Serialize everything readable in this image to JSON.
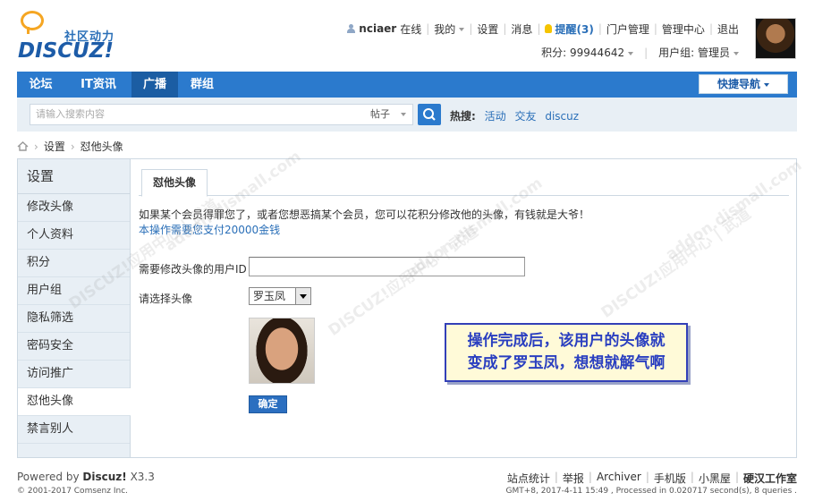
{
  "logo": {
    "slogan": "社区动力",
    "brand": "DISCUZ!"
  },
  "userbar": {
    "username": "nciaer",
    "status": "在线",
    "my": "我的",
    "settings": "设置",
    "messages": "消息",
    "remind": "提醒(3)",
    "portal_manage": "门户管理",
    "admin_center": "管理中心",
    "logout": "退出",
    "points": "积分: 99944642",
    "usergroup": "用户组: 管理员"
  },
  "nav": {
    "items": [
      "论坛",
      "IT资讯",
      "广播",
      "群组"
    ],
    "active": "广播",
    "quicknav": "快捷导航"
  },
  "search": {
    "placeholder": "请输入搜索内容",
    "type": "帖子",
    "hot_label": "热搜:",
    "hot_keywords": [
      "活动",
      "交友",
      "discuz"
    ]
  },
  "breadcrumb": {
    "items": [
      "设置",
      "怼他头像"
    ]
  },
  "sidebar": {
    "title": "设置",
    "items": [
      "修改头像",
      "个人资料",
      "积分",
      "用户组",
      "隐私筛选",
      "密码安全",
      "访问推广",
      "怼他头像",
      "禁言别人"
    ],
    "active": "怼他头像"
  },
  "main": {
    "tab": "怼他头像",
    "intro": "如果某个会员得罪您了，或者您想恶搞某个会员，您可以花积分修改他的头像，有钱就是大爷！",
    "cost": "本操作需要您支付20000金钱",
    "uid_label": "需要修改头像的用户ID",
    "uid_value": "",
    "avatar_label": "请选择头像",
    "avatar_selected": "罗玉凤",
    "submit": "确定"
  },
  "callout": {
    "line1": "操作完成后，该用户的头像就",
    "line2": "变成了罗玉凤，想想就解气啊"
  },
  "watermark": {
    "text": "DISCUZ!应用中心 | 武道",
    "sub": "addon.dismall.com"
  },
  "footer": {
    "powered_prefix": "Powered by",
    "powered_brand": "Discuz!",
    "version": "X3.3",
    "copyright": "© 2001-2017 Comsenz Inc.",
    "links": [
      "站点统计",
      "举报",
      "Archiver",
      "手机版",
      "小黑屋"
    ],
    "studio": "硬汉工作室",
    "stats": "GMT+8, 2017-4-11 15:49 , Processed in 0.020717 second(s), 8 queries ."
  },
  "colors": {
    "nav": "#2b7acd",
    "nav_active": "#1b5da3",
    "sidebar": "#e8eff5",
    "link": "#2a6fb8",
    "callout_border": "#3340b8"
  }
}
